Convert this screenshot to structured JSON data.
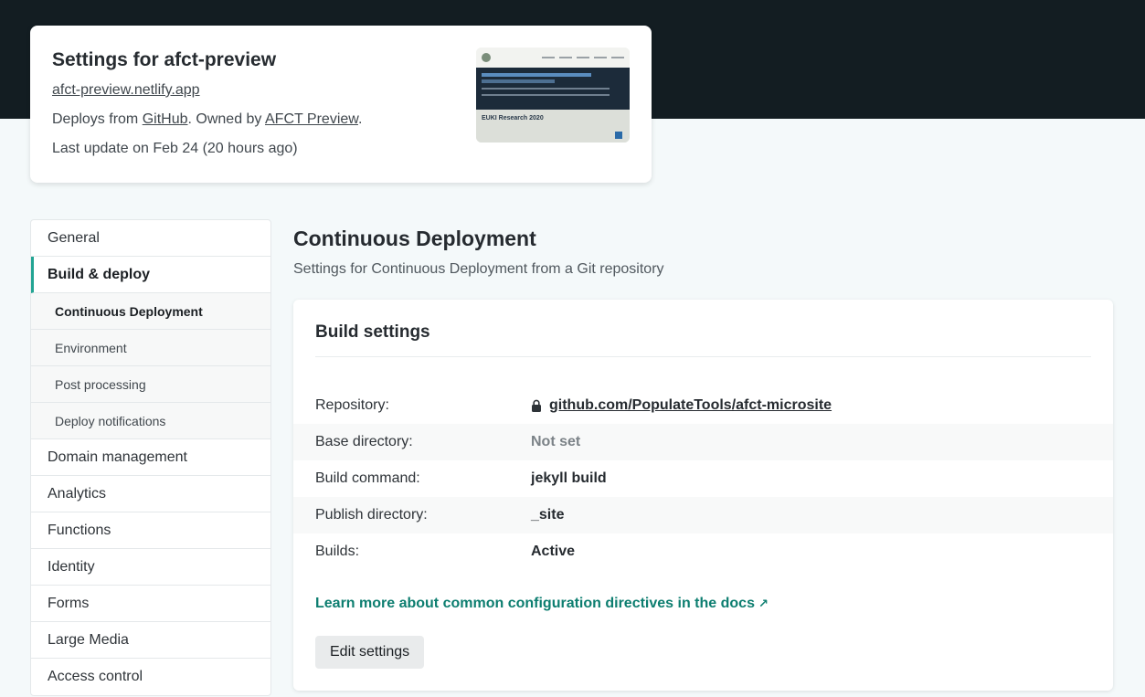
{
  "site": {
    "title": "Settings for afct-preview",
    "url": "afct-preview.netlify.app",
    "deploys_prefix": "Deploys from ",
    "deploys_source": "GitHub",
    "owned_prefix": ". Owned by ",
    "owner": "AFCT Preview",
    "owned_suffix": ".",
    "last_update": "Last update on Feb 24 (20 hours ago)",
    "thumbnail": {
      "hero_heading": "The Future of Corporate Sustainability Reporting",
      "report_title": "EUKI Research 2020"
    }
  },
  "sidebar": {
    "items": [
      {
        "label": "General"
      },
      {
        "label": "Build & deploy",
        "active": true,
        "children": [
          {
            "label": "Continuous Deployment",
            "current": true
          },
          {
            "label": "Environment"
          },
          {
            "label": "Post processing"
          },
          {
            "label": "Deploy notifications"
          }
        ]
      },
      {
        "label": "Domain management"
      },
      {
        "label": "Analytics"
      },
      {
        "label": "Functions"
      },
      {
        "label": "Identity"
      },
      {
        "label": "Forms"
      },
      {
        "label": "Large Media"
      },
      {
        "label": "Access control"
      }
    ]
  },
  "main": {
    "title": "Continuous Deployment",
    "subtitle": "Settings for Continuous Deployment from a Git repository",
    "panel": {
      "title": "Build settings",
      "rows": [
        {
          "label": "Repository:",
          "value": "github.com/PopulateTools/afct-microsite",
          "icon": "lock-icon"
        },
        {
          "label": "Base directory:",
          "value": "Not set",
          "muted": true
        },
        {
          "label": "Build command:",
          "value": "jekyll build"
        },
        {
          "label": "Publish directory:",
          "value": "_site"
        },
        {
          "label": "Builds:",
          "value": "Active"
        }
      ],
      "docs_link": "Learn more about common configuration directives in the docs",
      "docs_link_arrow": "↗",
      "edit_button": "Edit settings"
    }
  },
  "colors": {
    "header_bg": "#131d22",
    "page_bg": "#f4f9fa",
    "accent": "#22a493",
    "link_teal": "#0d7e70"
  }
}
